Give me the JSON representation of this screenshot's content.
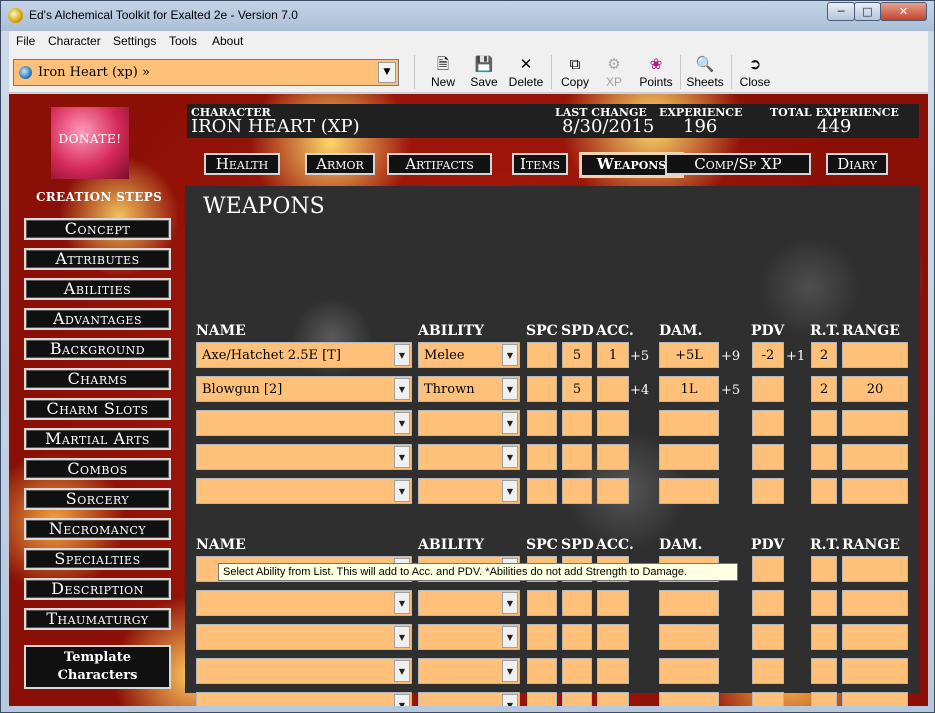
{
  "window": {
    "title": "Ed's Alchemical Toolkit for Exalted 2e - Version 7.0"
  },
  "menu": [
    "File",
    "Character",
    "Settings",
    "Tools",
    "About"
  ],
  "toolbar": {
    "character_select": "Iron Heart (xp) »",
    "buttons": {
      "new": "New",
      "save": "Save",
      "delete": "Delete",
      "copy": "Copy",
      "xp": "XP",
      "points": "Points",
      "sheets": "Sheets",
      "close": "Close"
    }
  },
  "donate": "DONATE!",
  "creation_steps_title": "CREATION STEPS",
  "creation_steps": [
    "Concept",
    "Attributes",
    "Abilities",
    "Advantages",
    "Background",
    "Charms",
    "Charm Slots",
    "Martial Arts",
    "Combos",
    "Sorcery",
    "Necromancy",
    "Specialties",
    "Description",
    "Thaumaturgy"
  ],
  "template_characters": [
    "Template",
    "Characters"
  ],
  "header": {
    "character_label": "CHARACTER",
    "character_value": "IRON HEART (XP)",
    "last_change_label": "LAST CHANGE",
    "last_change_value": "8/30/2015",
    "experience_label": "EXPERIENCE",
    "experience_value": "196",
    "total_experience_label": "TOTAL EXPERIENCE",
    "total_experience_value": "449"
  },
  "tabs": [
    "Health",
    "Armor",
    "Artifacts",
    "Items",
    "Weapons",
    "Comp/Sp XP",
    "Diary"
  ],
  "active_tab": "Weapons",
  "panel_title": "WEAPONS",
  "columns": {
    "name": "NAME",
    "ability": "ABILITY",
    "spc": "SPC",
    "spd": "SPD",
    "acc": "ACC.",
    "dam": "DAM.",
    "pdv": "PDV",
    "rt": "R.T.",
    "range": "RANGE"
  },
  "melee_rows": [
    {
      "name": "Axe/Hatchet 2.5E [T]",
      "ability": "Melee",
      "spc": "",
      "spd": "5",
      "acc": "1",
      "acc_bonus": "+5",
      "dam": "+5L",
      "dam_bonus": "+9",
      "pdv": "-2",
      "pdv_bonus": "+1",
      "rt": "2",
      "range": ""
    },
    {
      "name": "Blowgun [2]",
      "ability": "Thrown",
      "spc": "",
      "spd": "5",
      "acc": "",
      "acc_bonus": "+4",
      "dam": "1L",
      "dam_bonus": "+5",
      "pdv": "",
      "pdv_bonus": "",
      "rt": "2",
      "range": "20"
    },
    {
      "name": "",
      "ability": "",
      "spc": "",
      "spd": "",
      "acc": "",
      "acc_bonus": "",
      "dam": "",
      "dam_bonus": "",
      "pdv": "",
      "pdv_bonus": "",
      "rt": "",
      "range": ""
    },
    {
      "name": "",
      "ability": "",
      "spc": "",
      "spd": "",
      "acc": "",
      "acc_bonus": "",
      "dam": "",
      "dam_bonus": "",
      "pdv": "",
      "pdv_bonus": "",
      "rt": "",
      "range": ""
    },
    {
      "name": "",
      "ability": "",
      "spc": "",
      "spd": "",
      "acc": "",
      "acc_bonus": "",
      "dam": "",
      "dam_bonus": "",
      "pdv": "",
      "pdv_bonus": "",
      "rt": "",
      "range": ""
    }
  ],
  "second_rows": [
    {
      "name": "",
      "ability": "",
      "spc": "",
      "spd": "",
      "acc": "",
      "dam": "",
      "pdv": "",
      "rt": "",
      "range": ""
    },
    {
      "name": "",
      "ability": "",
      "spc": "",
      "spd": "",
      "acc": "",
      "dam": "",
      "pdv": "",
      "rt": "",
      "range": ""
    },
    {
      "name": "",
      "ability": "",
      "spc": "",
      "spd": "",
      "acc": "",
      "dam": "",
      "pdv": "",
      "rt": "",
      "range": ""
    },
    {
      "name": "",
      "ability": "",
      "spc": "",
      "spd": "",
      "acc": "",
      "dam": "",
      "pdv": "",
      "rt": "",
      "range": ""
    },
    {
      "name": "",
      "ability": "",
      "spc": "",
      "spd": "",
      "acc": "",
      "dam": "",
      "pdv": "",
      "rt": "",
      "range": ""
    }
  ],
  "tooltip": "Select Ability from List.  This will add to Acc. and PDV.  *Abilities do not add Strength to Damage.",
  "colors": {
    "field": "#ffc07a",
    "button_bg": "#101010",
    "background_red": "#a3170b"
  }
}
